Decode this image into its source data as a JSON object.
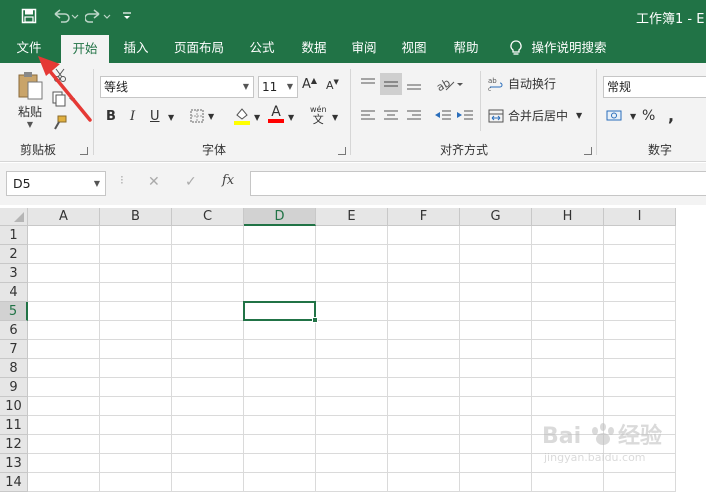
{
  "title_bar": {
    "title": "工作簿1 - E",
    "save_icon": "save-icon",
    "undo_icon": "undo-icon",
    "redo_icon": "redo-icon",
    "customize_icon": "customize-qat-icon"
  },
  "tabs": [
    {
      "label": "文件"
    },
    {
      "label": "开始"
    },
    {
      "label": "插入"
    },
    {
      "label": "页面布局"
    },
    {
      "label": "公式"
    },
    {
      "label": "数据"
    },
    {
      "label": "审阅"
    },
    {
      "label": "视图"
    },
    {
      "label": "帮助"
    },
    {
      "label": "操作说明搜索"
    }
  ],
  "ribbon": {
    "clipboard": {
      "paste_label": "粘贴",
      "group_label": "剪贴板"
    },
    "font": {
      "font_name": "等线",
      "font_size": "11",
      "bold": "B",
      "italic": "I",
      "underline": "U",
      "wen": "wén",
      "wen2": "文",
      "group_label": "字体"
    },
    "alignment": {
      "wrap_text": "自动换行",
      "merge_center": "合并后居中",
      "group_label": "对齐方式"
    },
    "number": {
      "format": "常规",
      "percent": "%",
      "comma": ",",
      "group_label": "数字"
    },
    "colors": {
      "accent": "#217346",
      "highlight": "#ffff00",
      "font_color": "#ff0000"
    }
  },
  "formula_bar": {
    "name_box": "D5",
    "cancel": "✕",
    "enter": "✓",
    "fx": "fx",
    "value": ""
  },
  "grid": {
    "columns": [
      "A",
      "B",
      "C",
      "D",
      "E",
      "F",
      "G",
      "H",
      "I"
    ],
    "rows": [
      "1",
      "2",
      "3",
      "4",
      "5",
      "6",
      "7",
      "8",
      "9",
      "10",
      "11",
      "12",
      "13",
      "14"
    ],
    "selected_cell": "D5"
  },
  "watermark": {
    "brand": "Baidu经验",
    "url": "jingyan.baidu.com"
  }
}
